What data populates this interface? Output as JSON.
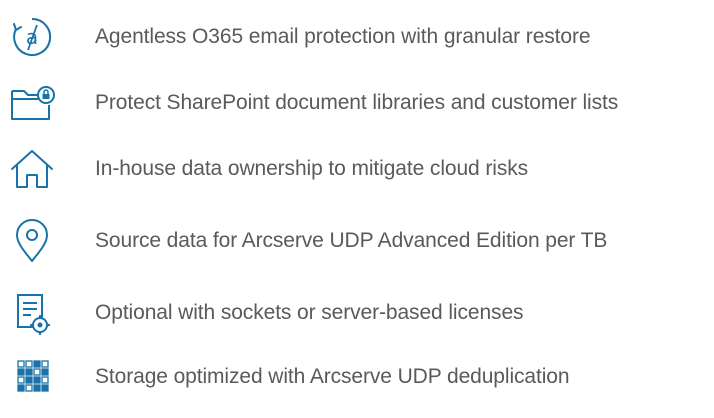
{
  "features": [
    {
      "icon": "o365-email-icon",
      "text": "Agentless O365 email protection with granular restore"
    },
    {
      "icon": "locked-folder-icon",
      "text": "Protect SharePoint document libraries and customer lists"
    },
    {
      "icon": "house-icon",
      "text": "In-house data ownership to mitigate cloud risks"
    },
    {
      "icon": "location-pin-icon",
      "text": "Source data for Arcserve UDP Advanced Edition per TB"
    },
    {
      "icon": "license-document-gear-icon",
      "text": "Optional with sockets or server-based licenses"
    },
    {
      "icon": "deduplication-grid-icon",
      "text": "Storage optimized with Arcserve UDP deduplication"
    }
  ],
  "colors": {
    "icon_primary": "#1a73a8",
    "text": "#5a5a5a",
    "background": "#ffffff"
  }
}
